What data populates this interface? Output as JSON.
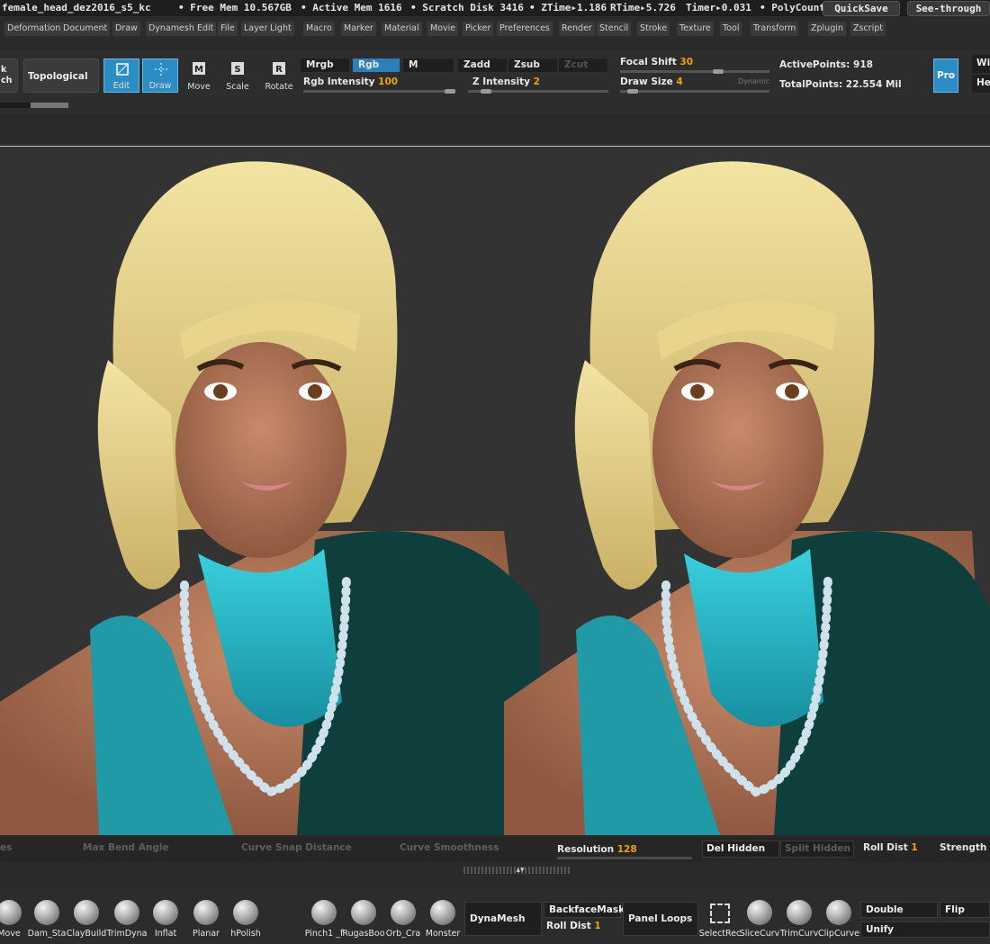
{
  "titlebar": {
    "doc_name": "female_head_dez2016_s5_kc",
    "free_mem": "• Free Mem 10.567GB",
    "active_mem": "• Active Mem 1616",
    "scratch": "• Scratch Disk 3416",
    "ztime": "• ZTime▸1.186",
    "rtime": "RTime▸5.726",
    "timer": "Timer▸0.031",
    "polycount": "• PolyCount",
    "quicksave": "QuickSave",
    "seethrough": "See-through"
  },
  "menu": [
    "Deformation",
    "Document",
    "Draw",
    "Dynamesh",
    "Edit",
    "File",
    "Layer",
    "Light",
    "Macro",
    "Marker",
    "Material",
    "Movie",
    "Picker",
    "Preferences",
    "Render",
    "Stencil",
    "Stroke",
    "Texture",
    "Tool",
    "Transform",
    "Zplugin",
    "Zscript"
  ],
  "shelf": {
    "left_cut": "k\nch",
    "topological": "Topological",
    "tools": [
      {
        "label": "Edit",
        "icon": "edit-icon"
      },
      {
        "label": "Draw",
        "icon": "draw-icon"
      },
      {
        "label": "Move",
        "icon": "move-icon"
      },
      {
        "label": "Scale",
        "icon": "scale-icon"
      },
      {
        "label": "Rotate",
        "icon": "rotate-icon"
      }
    ],
    "mrgb": "Mrgb",
    "rgb": "Rgb",
    "m": "M",
    "zadd": "Zadd",
    "zsub": "Zsub",
    "zcut": "Zcut",
    "rgb_intensity_label": "Rgb Intensity",
    "rgb_intensity": "100",
    "z_intensity_label": "Z Intensity",
    "z_intensity": "2",
    "focal_label": "Focal Shift",
    "focal": "30",
    "draw_size_label": "Draw Size",
    "draw_size": "4",
    "dynamic": "Dynamic",
    "active_points": "ActivePoints: 918",
    "total_points": "TotalPoints: 22.554 Mil",
    "pro": "Pro",
    "wi": "Wi",
    "he": "He"
  },
  "bottombar": {
    "es": "es",
    "max_bend": "Max Bend Angle",
    "curve_snap": "Curve Snap Distance",
    "curve_smooth": "Curve Smoothness",
    "resolution_label": "Resolution",
    "resolution": "128",
    "del_hidden": "Del Hidden",
    "split_hidden": "Split Hidden",
    "roll_dist_label": "Roll Dist",
    "roll_dist": "1",
    "strength": "Strength"
  },
  "tray": {
    "brushes_left": [
      "Move",
      "Dam_Sta",
      "ClayBuild",
      "TrimDyna",
      "Inflat",
      "Planar",
      "hPolish"
    ],
    "brushes_mid": [
      "Pinch1 _f",
      "RugasBoo",
      "Orb_Cra",
      "Monster"
    ],
    "dynamesh": "DynaMesh",
    "backface": "BackfaceMask",
    "roll_dist_label": "Roll Dist",
    "roll_dist": "1",
    "panel_loops": "Panel Loops",
    "brushes_right": [
      "SelectRec",
      "SliceCurv",
      "TrimCurv",
      "ClipCurve"
    ],
    "double": "Double",
    "flip": "Flip",
    "unify": "Unify"
  },
  "colors": {
    "accent": "#2c8cc4",
    "value": "#f0a400",
    "hair": "#e8d48a",
    "scarf": "#29b8c8",
    "skin": "#b87a5e"
  }
}
